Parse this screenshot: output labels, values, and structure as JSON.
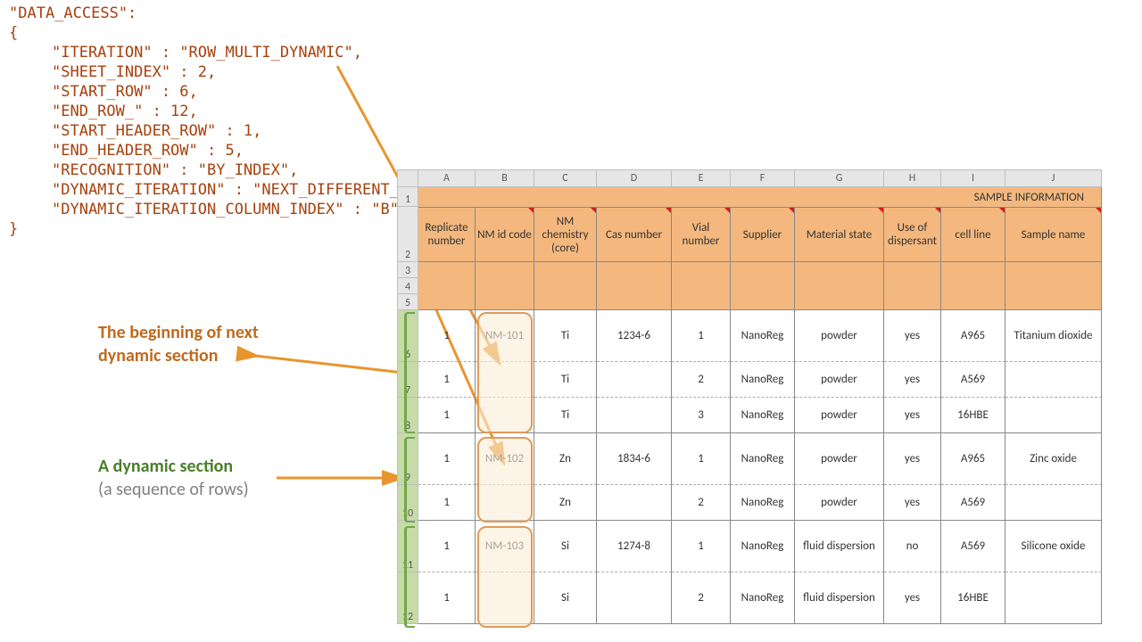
{
  "code": {
    "line0": "\"DATA_ACCESS\":",
    "line1": "{",
    "line2": "\"ITERATION\" : \"ROW_MULTI_DYNAMIC\",",
    "line3": "\"SHEET_INDEX\" : 2,",
    "line4": "\"START_ROW\" : 6,",
    "line5": "\"END_ROW_\" : 12,",
    "line6": "\"START_HEADER_ROW\" : 1,",
    "line7": "\"END_HEADER_ROW\" : 5,",
    "line8": "",
    "line9": "\"RECOGNITION\" : \"BY_INDEX\",",
    "line10": "\"DYNAMIC_ITERATION\" : \"NEXT_DIFFERENT_VALUE\",",
    "line11": "\"DYNAMIC_ITERATION_COLUMN_INDEX\" : \"B\",",
    "line12": "}"
  },
  "annotations": {
    "orange_l1": "The beginning of next",
    "orange_l2": "dynamic section",
    "green_l1": "A dynamic section",
    "green_l2": "(a sequence of rows)"
  },
  "sheet": {
    "cols": [
      "A",
      "B",
      "C",
      "D",
      "E",
      "F",
      "G",
      "H",
      "I",
      "J"
    ],
    "rownums": [
      "1",
      "2",
      "3",
      "4",
      "5",
      "6",
      "7",
      "8",
      "9",
      "10",
      "11",
      "12"
    ],
    "header_title": "SAMPLE INFORMATION",
    "headers": {
      "A": "Replicate number",
      "B": "NM id code",
      "C": "NM chemistry (core)",
      "D": "Cas number",
      "E": "Vial number",
      "F": "Supplier",
      "G": "Material state",
      "H": "Use of dispersant",
      "I": "cell line",
      "J": "Sample name"
    },
    "data": {
      "r6": {
        "A": "1",
        "B": "NM-101",
        "C": "Ti",
        "D": "1234-6",
        "E": "1",
        "F": "NanoReg",
        "G": "powder",
        "H": "yes",
        "I": "A965",
        "J": "Titanium dioxide"
      },
      "r7": {
        "A": "1",
        "B": "",
        "C": "Ti",
        "D": "",
        "E": "2",
        "F": "NanoReg",
        "G": "powder",
        "H": "yes",
        "I": "A569",
        "J": ""
      },
      "r8": {
        "A": "1",
        "B": "",
        "C": "Ti",
        "D": "",
        "E": "3",
        "F": "NanoReg",
        "G": "powder",
        "H": "yes",
        "I": "16HBE",
        "J": ""
      },
      "r9": {
        "A": "1",
        "B": "NM-102",
        "C": "Zn",
        "D": "1834-6",
        "E": "1",
        "F": "NanoReg",
        "G": "powder",
        "H": "yes",
        "I": "A965",
        "J": "Zinc oxide"
      },
      "r10": {
        "A": "1",
        "B": "",
        "C": "Zn",
        "D": "",
        "E": "2",
        "F": "NanoReg",
        "G": "powder",
        "H": "yes",
        "I": "A569",
        "J": ""
      },
      "r11": {
        "A": "1",
        "B": "NM-103",
        "C": "Si",
        "D": "1274-8",
        "E": "1",
        "F": "NanoReg",
        "G": "fluid dispersion",
        "H": "no",
        "I": "A569",
        "J": "Silicone oxide"
      },
      "r12": {
        "A": "1",
        "B": "",
        "C": "Si",
        "D": "",
        "E": "2",
        "F": "NanoReg",
        "G": "fluid dispersion",
        "H": "yes",
        "I": "16HBE",
        "J": ""
      }
    }
  }
}
